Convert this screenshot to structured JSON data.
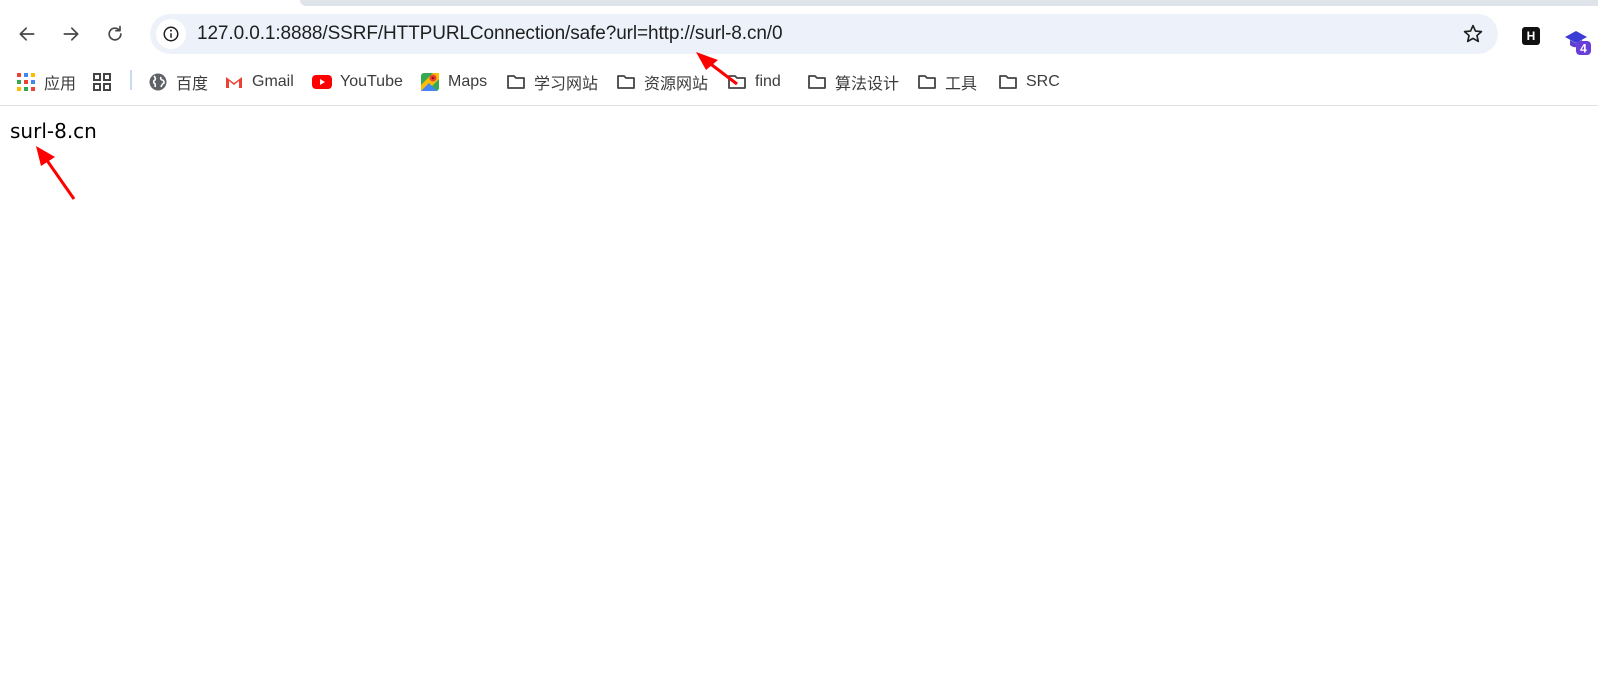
{
  "browser": {
    "url": "127.0.0.1:8888/SSRF/HTTPURLConnection/safe?url=http://surl-8.cn/0",
    "extension_badge": "4",
    "extension_h_label": "H"
  },
  "bookmarks": {
    "items": [
      {
        "label": "应用",
        "icon": "apps-grid-icon"
      },
      {
        "label": "",
        "icon": "tab-groups-icon"
      },
      {
        "label": "百度",
        "icon": "globe-icon"
      },
      {
        "label": "Gmail",
        "icon": "gmail-icon"
      },
      {
        "label": "YouTube",
        "icon": "youtube-icon"
      },
      {
        "label": "Maps",
        "icon": "maps-icon"
      },
      {
        "label": "学习网站",
        "icon": "folder-icon"
      },
      {
        "label": "资源网站",
        "icon": "folder-icon"
      },
      {
        "label": "find",
        "icon": "folder-icon"
      },
      {
        "label": "算法设计",
        "icon": "folder-icon"
      },
      {
        "label": "工具",
        "icon": "folder-icon"
      },
      {
        "label": "SRC",
        "icon": "folder-icon"
      }
    ]
  },
  "page": {
    "body_text": "surl-8.cn"
  },
  "colors": {
    "annotation_arrow": "#ff0000",
    "omnibox_bg": "#edf2fa"
  }
}
